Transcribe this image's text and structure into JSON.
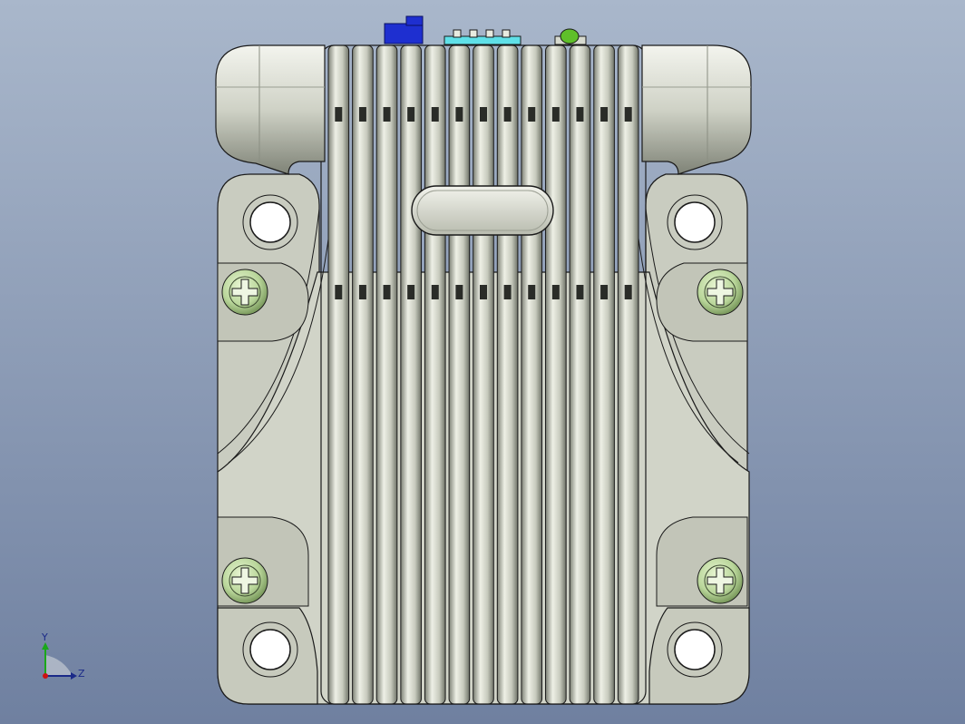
{
  "viewport": {
    "background_top": "#a9b7cb",
    "background_bottom": "#6f80a0",
    "body_color": "#cfd2c6",
    "body_shadow": "#8e9286",
    "edge_color": "#1a1a1a",
    "screw_color": "#b9d69a",
    "connector_blue": "#1e2fd0",
    "connector_cyan": "#5fe0e8",
    "led_green": "#5fbf2a"
  },
  "triad": {
    "y_label": "Y",
    "z_label": "Z",
    "y_color": "#1aa81a",
    "z_color": "#1b2a88",
    "x_color": "#cc1111"
  },
  "model": {
    "fin_count": 13,
    "screws": [
      "top-left",
      "top-right",
      "bottom-left",
      "bottom-right"
    ],
    "mount_holes": [
      "top-left",
      "top-right",
      "bottom-left",
      "bottom-right"
    ]
  }
}
